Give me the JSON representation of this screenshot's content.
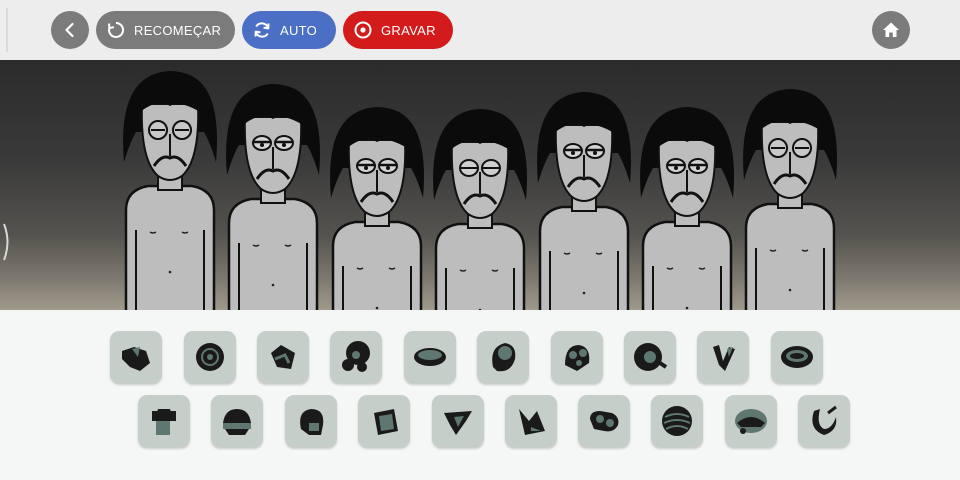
{
  "toolbar": {
    "back_icon": "chevron-left-icon",
    "restart_label": "RECOMEÇAR",
    "restart_icon": "restart-icon",
    "auto_label": "AUTO",
    "auto_icon": "refresh-icon",
    "record_label": "GRAVAR",
    "record_icon": "record-icon",
    "home_icon": "home-icon"
  },
  "colors": {
    "toolbar_bg": "#ededed",
    "button_gray": "#7b7b7b",
    "auto_blue": "#4a6fc4",
    "record_red": "#d31b1b",
    "slot_bg": "#c6cec9",
    "icon_dark": "#1a1a1a",
    "icon_teal": "#5e7770"
  },
  "stage": {
    "characters": [
      "character-1",
      "character-2",
      "character-3",
      "character-4",
      "character-5",
      "character-6",
      "character-7"
    ]
  },
  "sound_icons": {
    "row1": [
      "sound-icon-1",
      "sound-icon-2",
      "sound-icon-3",
      "sound-icon-4",
      "sound-icon-5",
      "sound-icon-6",
      "sound-icon-7",
      "sound-icon-8",
      "sound-icon-9",
      "sound-icon-10"
    ],
    "row2": [
      "sound-icon-11",
      "sound-icon-12",
      "sound-icon-13",
      "sound-icon-14",
      "sound-icon-15",
      "sound-icon-16",
      "sound-icon-17",
      "sound-icon-18",
      "sound-icon-19",
      "sound-icon-20"
    ]
  }
}
